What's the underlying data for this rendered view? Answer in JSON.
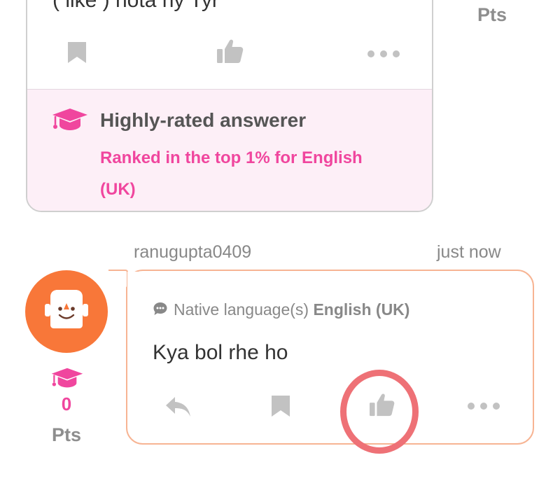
{
  "top_card": {
    "cut_text": "( like ) hota hy Tyr",
    "badge": {
      "title": "Highly-rated answerer",
      "subtitle": "Ranked in the top 1% for English (UK)"
    }
  },
  "top_points_label": "Pts",
  "answer": {
    "username": "ranugupta0409",
    "timestamp": "just now",
    "native_label": "Native language(s)",
    "native_language": "English (UK)",
    "text": "Kya bol rhe ho",
    "points_value": "0",
    "points_label": "Pts"
  },
  "colors": {
    "accent_pink": "#f0469e",
    "avatar_orange": "#f87739",
    "bubble_border": "#f7b493",
    "badge_bg": "#fdeff7",
    "highlight_ring": "#ee7176",
    "icon_gray": "#c2c2c2"
  },
  "icons": {
    "bookmark": "bookmark-icon",
    "like": "thumbs-up-icon",
    "more": "more-dots-icon",
    "reply": "reply-icon",
    "badge": "graduation-cap-icon",
    "native": "speech-bubble-icon"
  }
}
